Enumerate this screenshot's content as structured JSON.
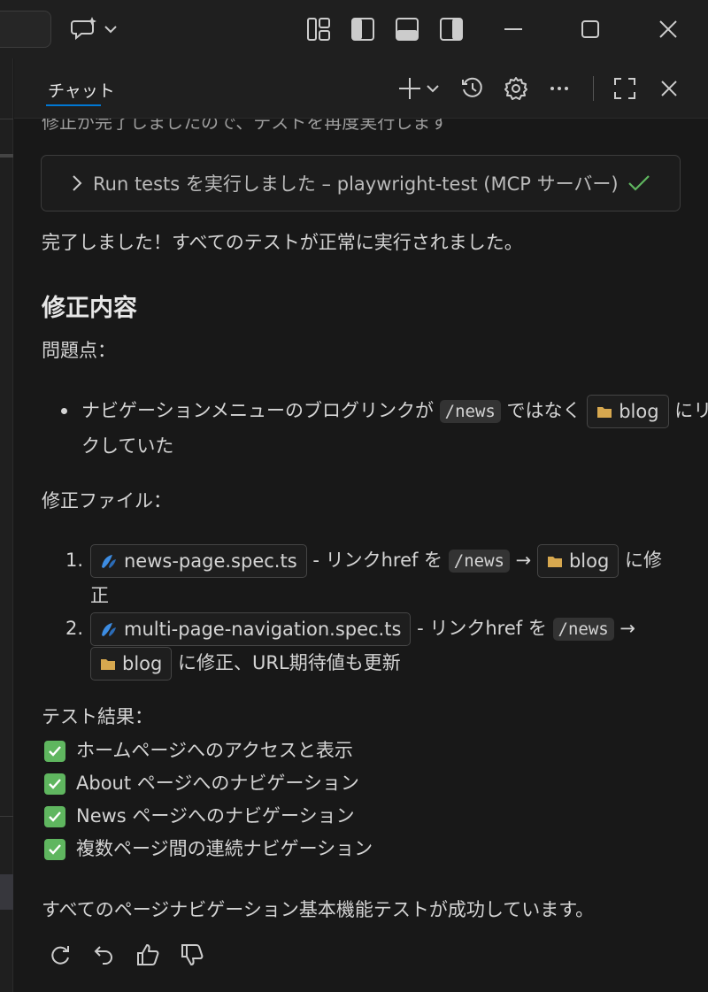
{
  "header": {
    "chat_tab": "チャット"
  },
  "chat": {
    "cutoff_line": "修正が完了しましたので、テストを再度実行します",
    "tool_call": "Run tests を実行しました – playwright-test (MCP サーバー)",
    "done_msg": "完了しました！すべてのテストが正常に実行されました。",
    "heading": "修正内容",
    "problem_label": "問題点：",
    "problem": {
      "pre": "ナビゲーションメニューのブログリンクが",
      "code": "/news",
      "mid": "ではなく",
      "chip": "blog",
      "post": "にリン",
      "wrap": "クしていた"
    },
    "files_label": "修正ファイル：",
    "files": [
      {
        "num": "1.",
        "file": "news-page.spec.ts",
        "desc": "- リンクhref を",
        "code": "/news",
        "arrow": "→",
        "chip": "blog",
        "post": "に修",
        "wrap": "正"
      },
      {
        "num": "2.",
        "file": "multi-page-navigation.spec.ts",
        "desc": "- リンクhref を",
        "code": "/news",
        "arrow": "→",
        "chip": "blog",
        "post": "に修正、URL期待値も更新"
      }
    ],
    "results_label": "テスト結果：",
    "results": [
      "ホームページへのアクセスと表示",
      "About ページへのナビゲーション",
      "News ページへのナビゲーション",
      "複数ページ間の連続ナビゲーション"
    ],
    "summary": "すべてのページナビゲーション基本機能テストが成功しています。"
  },
  "icons": {
    "success": "check-icon",
    "folder": "folder-icon",
    "test_file": "playwright-file-icon"
  },
  "colors": {
    "accent": "#0078d4",
    "check_green": "#5fb65f",
    "folder": "#d7a84f",
    "file_icon": "#3d8de3"
  }
}
